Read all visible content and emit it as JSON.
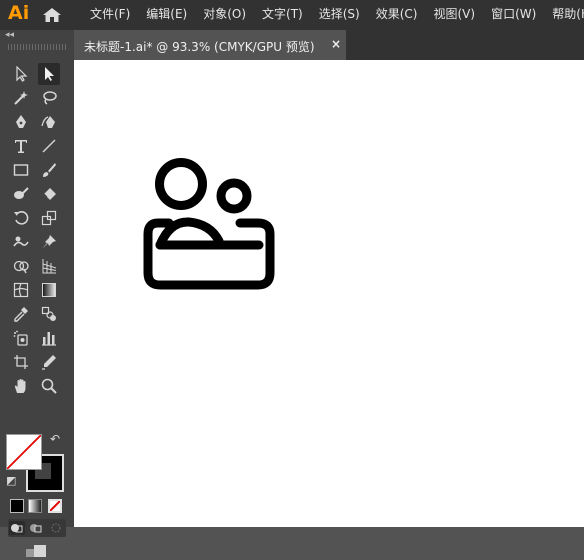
{
  "app": {
    "logo": "Ai"
  },
  "menu": {
    "items": [
      "文件(F)",
      "编辑(E)",
      "对象(O)",
      "文字(T)",
      "选择(S)",
      "效果(C)",
      "视图(V)",
      "窗口(W)",
      "帮助(H)"
    ]
  },
  "toolbar": {
    "collapse": "◂◂",
    "tools": [
      {
        "name": "selection-tool",
        "icon": "arrow-outline-icon"
      },
      {
        "name": "direct-selection-tool",
        "icon": "arrow-filled-icon",
        "active": true
      },
      {
        "name": "magic-wand-tool",
        "icon": "magic-wand-icon"
      },
      {
        "name": "lasso-tool",
        "icon": "lasso-icon"
      },
      {
        "name": "pen-tool",
        "icon": "pen-icon"
      },
      {
        "name": "curvature-tool",
        "icon": "curvature-pen-icon"
      },
      {
        "name": "type-tool",
        "icon": "type-icon"
      },
      {
        "name": "line-tool",
        "icon": "line-icon"
      },
      {
        "name": "rectangle-tool",
        "icon": "rectangle-icon"
      },
      {
        "name": "paintbrush-tool",
        "icon": "brush-icon"
      },
      {
        "name": "blob-brush-tool",
        "icon": "blob-brush-icon"
      },
      {
        "name": "eraser-tool",
        "icon": "eraser-icon"
      },
      {
        "name": "rotate-tool",
        "icon": "rotate-icon"
      },
      {
        "name": "scale-tool",
        "icon": "scale-icon"
      },
      {
        "name": "warp-tool",
        "icon": "warp-icon"
      },
      {
        "name": "puppet-warp-tool",
        "icon": "pin-icon"
      },
      {
        "name": "shape-builder-tool",
        "icon": "shape-builder-icon"
      },
      {
        "name": "perspective-grid-tool",
        "icon": "perspective-icon"
      },
      {
        "name": "mesh-tool",
        "icon": "mesh-icon"
      },
      {
        "name": "gradient-tool",
        "icon": "gradient-icon"
      },
      {
        "name": "eyedropper-tool",
        "icon": "eyedropper-icon"
      },
      {
        "name": "blend-tool",
        "icon": "blend-icon"
      },
      {
        "name": "symbol-sprayer-tool",
        "icon": "symbol-sprayer-icon"
      },
      {
        "name": "column-graph-tool",
        "icon": "bar-graph-icon"
      },
      {
        "name": "artboard-tool",
        "icon": "artboard-icon"
      },
      {
        "name": "slice-tool",
        "icon": "slice-icon"
      },
      {
        "name": "hand-tool",
        "icon": "hand-icon"
      },
      {
        "name": "zoom-tool",
        "icon": "magnifier-icon"
      }
    ],
    "fill_color": "none",
    "stroke_color": "#000000",
    "swap_symbol": "↶",
    "default_colors_symbol": "◩"
  },
  "document": {
    "tab_title": "未标题-1.ai* @ 93.3% (CMYK/GPU 预览)",
    "close_symbol": "×"
  },
  "colors": {
    "menubar_bg": "#323232",
    "panel_bg": "#424242",
    "workspace_bg": "#535353",
    "canvas_bg": "#ffffff",
    "accent": "#ff9a00",
    "artwork_stroke": "#000000"
  }
}
